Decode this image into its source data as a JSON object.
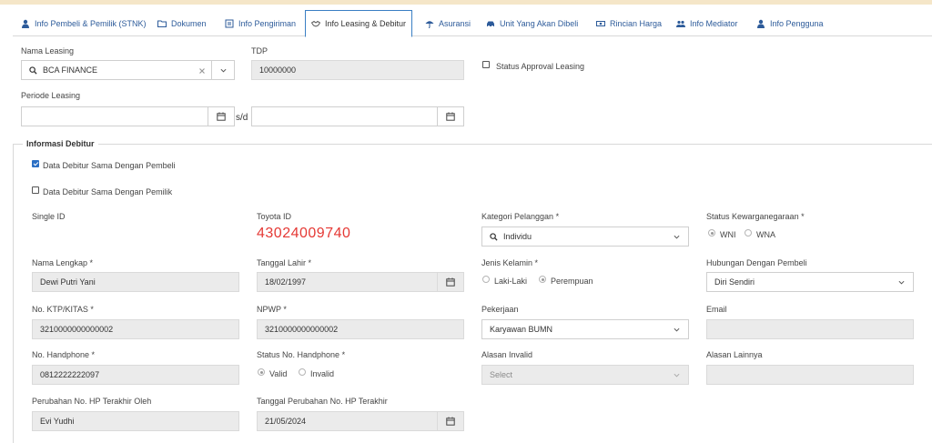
{
  "tabs": [
    {
      "label": "Info Pembeli & Pemilik (STNK)",
      "icon": "person-icon",
      "active": false
    },
    {
      "label": "Dokumen",
      "icon": "folder-icon",
      "active": false
    },
    {
      "label": "Info Pengiriman",
      "icon": "document-icon",
      "active": false
    },
    {
      "label": "Info Leasing & Debitur",
      "icon": "handshake-icon",
      "active": true
    },
    {
      "label": "Asuransi",
      "icon": "umbrella-icon",
      "active": false
    },
    {
      "label": "Unit Yang Akan Dibeli",
      "icon": "car-icon",
      "active": false
    },
    {
      "label": "Rincian Harga",
      "icon": "money-icon",
      "active": false
    },
    {
      "label": "Info Mediator",
      "icon": "users-icon",
      "active": false
    },
    {
      "label": "Info Pengguna",
      "icon": "person-icon",
      "active": false
    }
  ],
  "leasing": {
    "nama_leasing_label": "Nama Leasing",
    "nama_leasing_value": "BCA FINANCE",
    "tdp_label": "TDP",
    "tdp_value": "10000000",
    "status_approval_label": "Status Approval Leasing",
    "status_approval_checked": false,
    "periode_label": "Periode Leasing",
    "periode_from": "",
    "periode_to": "",
    "sd_label": "s/d"
  },
  "debitur": {
    "legend": "Informasi Debitur",
    "same_as_buyer_label": "Data Debitur Sama Dengan Pembeli",
    "same_as_buyer_checked": true,
    "same_as_owner_label": "Data Debitur Sama Dengan Pemilik",
    "same_as_owner_checked": false,
    "single_id_label": "Single ID",
    "toyota_id_label": "Toyota ID",
    "toyota_id_value": "43024009740",
    "kategori_label": "Kategori Pelanggan *",
    "kategori_value": "Individu",
    "kewarganegaraan_label": "Status Kewarganegaraan *",
    "wni_label": "WNI",
    "wna_label": "WNA",
    "nama_label": "Nama Lengkap *",
    "nama_value": "Dewi Putri Yani",
    "tgl_lahir_label": "Tanggal Lahir *",
    "tgl_lahir_value": "18/02/1997",
    "jenis_kelamin_label": "Jenis Kelamin *",
    "laki_label": "Laki-Laki",
    "perempuan_label": "Perempuan",
    "hubungan_label": "Hubungan Dengan Pembeli",
    "hubungan_value": "Diri Sendiri",
    "ktp_label": "No. KTP/KITAS *",
    "ktp_value": "3210000000000002",
    "npwp_label": "NPWP *",
    "npwp_value": "3210000000000002",
    "pekerjaan_label": "Pekerjaan",
    "pekerjaan_value": "Karyawan BUMN",
    "email_label": "Email",
    "email_value": "",
    "hp_label": "No. Handphone *",
    "hp_value": "0812222222097",
    "status_hp_label": "Status No. Handphone *",
    "valid_label": "Valid",
    "invalid_label": "Invalid",
    "alasan_invalid_label": "Alasan Invalid",
    "alasan_invalid_placeholder": "Select",
    "alasan_lainnya_label": "Alasan Lainnya",
    "alasan_lainnya_value": "",
    "perubahan_oleh_label": "Perubahan No. HP Terakhir Oleh",
    "perubahan_oleh_value": "Evi Yudhi",
    "tgl_perubahan_label": "Tanggal Perubahan No. HP Terakhir",
    "tgl_perubahan_value": "21/05/2024"
  },
  "colors": {
    "accent": "#2d5b9a",
    "toyota_id": "#e53935",
    "readonly_bg": "#ebebeb"
  }
}
